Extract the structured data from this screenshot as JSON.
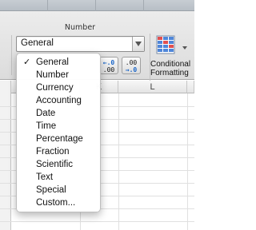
{
  "ribbon": {
    "group_title": "Number",
    "format_select_value": "General",
    "decimal_buttons": [
      {
        "top": "←.0",
        "bottom": ".00",
        "icon": "increase-decimal-icon"
      },
      {
        "top": ".00",
        "bottom": "→.0",
        "icon": "decrease-decimal-icon"
      }
    ],
    "conditional_formatting_label_line1": "Conditional",
    "conditional_formatting_label_line2": "Formatting"
  },
  "grid": {
    "column_headers": [
      "K",
      "L"
    ]
  },
  "menu": {
    "check_mark": "✓",
    "items": [
      {
        "label": "General",
        "checked": true
      },
      {
        "label": "Number",
        "checked": false
      },
      {
        "label": "Currency",
        "checked": false
      },
      {
        "label": "Accounting",
        "checked": false
      },
      {
        "label": "Date",
        "checked": false
      },
      {
        "label": "Time",
        "checked": false
      },
      {
        "label": "Percentage",
        "checked": false
      },
      {
        "label": "Fraction",
        "checked": false
      },
      {
        "label": "Scientific",
        "checked": false
      },
      {
        "label": "Text",
        "checked": false
      },
      {
        "label": "Special",
        "checked": false
      },
      {
        "label": "Custom...",
        "checked": false
      }
    ]
  },
  "colors": {
    "accent_blue": "#1c67c8",
    "ribbon_bg": "#e4e4e4"
  }
}
